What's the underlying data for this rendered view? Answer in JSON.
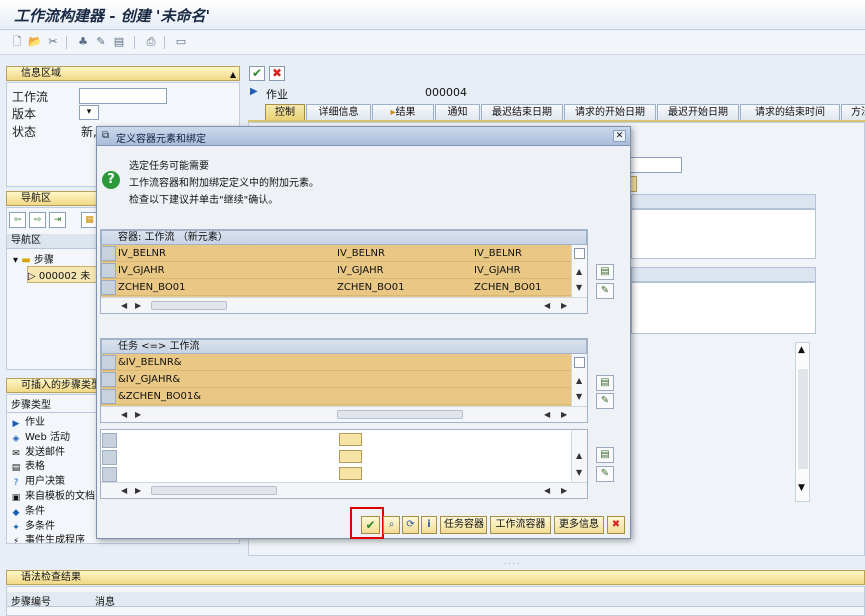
{
  "window": {
    "title": "工作流构建器 - 创建 '未命名'"
  },
  "left": {
    "info_section": "信息区域",
    "workflow_label": "工作流",
    "version_label": "版本",
    "status_label": "状态",
    "status_value": "新,",
    "nav_section": "导航区",
    "nav_col_header": "导航区",
    "tree_step": "步骤",
    "tree_item": "000002 未",
    "insertable_section": "可插入的步骤类型",
    "step_types_header": "步骤类型",
    "step_types": [
      "作业",
      "Web 活动",
      "发送邮件",
      "表格",
      "用户决策",
      "来自模板的文档",
      "条件",
      "多条件",
      "事件生成程序"
    ]
  },
  "right": {
    "task_label": "作业",
    "task_number": "000004",
    "tabs": [
      "控制",
      "详细信息",
      "结果",
      "通知",
      "最迟结束日期",
      "请求的开始日期",
      "最迟开始日期",
      "请求的结束时间",
      "方法"
    ]
  },
  "dialog": {
    "title": "定义容器元素和绑定",
    "message_lines": [
      "选定任务可能需要",
      "工作流容器和附加绑定定义中的附加元素。",
      "检查以下建议并单击\"继续\"确认。"
    ],
    "grid1": {
      "header": "容器: 工作流 （新元素）",
      "rows": [
        [
          "IV_BELNR",
          "IV_BELNR",
          "IV_BELNR"
        ],
        [
          "IV_GJAHR",
          "IV_GJAHR",
          "IV_GJAHR"
        ],
        [
          "ZCHEN_BO01",
          "ZCHEN_BO01",
          "ZCHEN_BO01"
        ]
      ]
    },
    "grid2": {
      "header": "任务 <=> 工作流",
      "rows": [
        "&IV_BELNR&",
        "&IV_GJAHR&",
        "&ZCHEN_BO01&"
      ]
    },
    "buttons": {
      "task_container": "任务容器",
      "workflow_container": "工作流容器",
      "more_info": "更多信息"
    }
  },
  "bottom": {
    "syntax_section": "语法检查结果",
    "col_step_no": "步骤编号",
    "col_message": "消息"
  },
  "colors": {
    "accent": "#e9c886",
    "highlight_border": "#e00000",
    "title_blue": "#a9bcd9"
  }
}
